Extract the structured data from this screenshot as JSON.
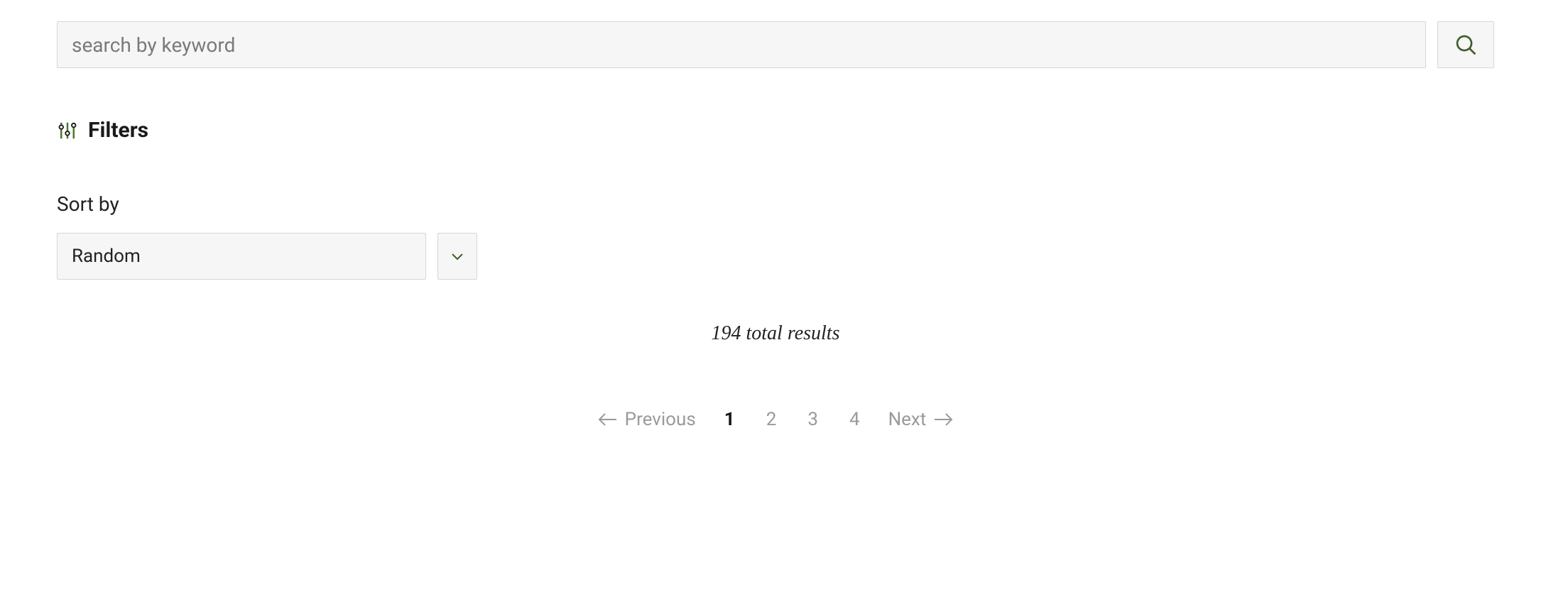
{
  "search": {
    "placeholder": "search by keyword",
    "value": ""
  },
  "filters": {
    "label": "Filters"
  },
  "sort": {
    "label": "Sort by",
    "selected": "Random"
  },
  "results": {
    "count_text": "194 total results"
  },
  "pagination": {
    "prev_label": "Previous",
    "next_label": "Next",
    "pages": [
      "1",
      "2",
      "3",
      "4"
    ],
    "current": "1"
  }
}
